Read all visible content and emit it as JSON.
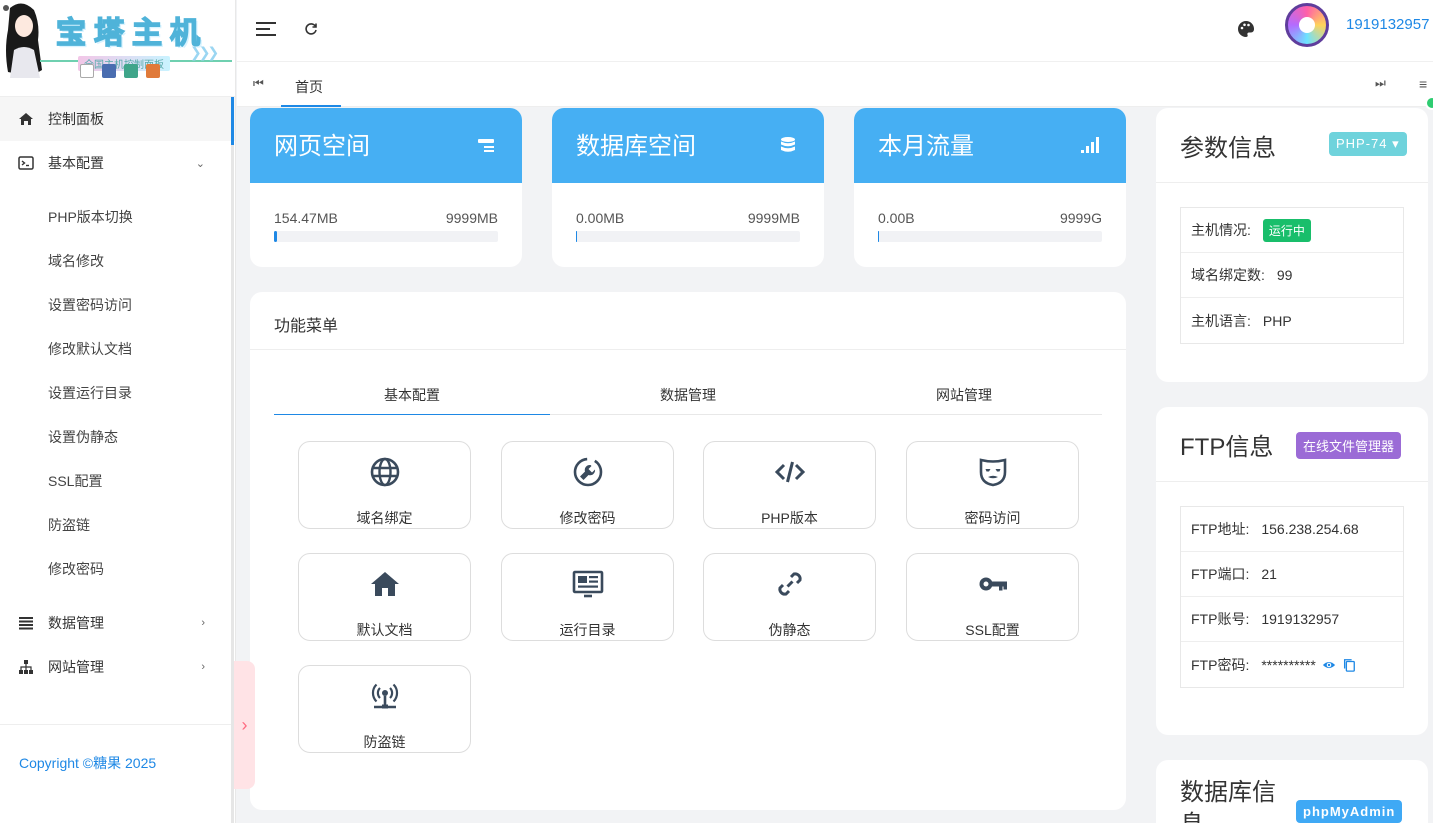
{
  "brand": {
    "title": "宝塔主机",
    "subtitle": "全国主机控制面板"
  },
  "sidebar": {
    "items": [
      {
        "label": "控制面板",
        "icon": "home-icon"
      },
      {
        "label": "基本配置",
        "icon": "terminal-icon"
      },
      {
        "label": "数据管理",
        "icon": "list-icon"
      },
      {
        "label": "网站管理",
        "icon": "sitemap-icon"
      }
    ],
    "sub_items": [
      "PHP版本切换",
      "域名修改",
      "设置密码访问",
      "修改默认文档",
      "设置运行目录",
      "设置伪静态",
      "SSL配置",
      "防盗链",
      "修改密码"
    ],
    "copyright": "Copyright ©糖果 2025"
  },
  "header": {
    "username": "1919132957"
  },
  "tabs": {
    "home": "首页"
  },
  "stats": [
    {
      "title": "网页空间",
      "used": "154.47MB",
      "total": "9999MB",
      "percent": 1.5,
      "icon": "server-icon"
    },
    {
      "title": "数据库空间",
      "used": "0.00MB",
      "total": "9999MB",
      "percent": 0.5,
      "icon": "database-icon"
    },
    {
      "title": "本月流量",
      "used": "0.00B",
      "total": "9999G",
      "percent": 0.5,
      "icon": "signal-icon"
    }
  ],
  "func_menu": {
    "title": "功能菜单",
    "tabs": [
      "基本配置",
      "数据管理",
      "网站管理"
    ],
    "buttons": [
      {
        "label": "域名绑定",
        "icon": "globe-icon"
      },
      {
        "label": "修改密码",
        "icon": "wrench-icon"
      },
      {
        "label": "PHP版本",
        "icon": "code-icon"
      },
      {
        "label": "密码访问",
        "icon": "mask-icon"
      },
      {
        "label": "默认文档",
        "icon": "home-icon"
      },
      {
        "label": "运行目录",
        "icon": "monitor-icon"
      },
      {
        "label": "伪静态",
        "icon": "link-icon"
      },
      {
        "label": "SSL配置",
        "icon": "key-icon"
      },
      {
        "label": "防盗链",
        "icon": "antenna-icon"
      }
    ]
  },
  "params": {
    "title": "参数信息",
    "php_badge": "PHP-74",
    "rows": [
      {
        "key": "主机情况:",
        "value": "运行中"
      },
      {
        "key": "域名绑定数:",
        "value": "99"
      },
      {
        "key": "主机语言:",
        "value": "PHP"
      }
    ]
  },
  "ftp": {
    "title": "FTP信息",
    "badge": "在线文件管理器",
    "rows": [
      {
        "key": "FTP地址:",
        "value": "156.238.254.68"
      },
      {
        "key": "FTP端口:",
        "value": "21"
      },
      {
        "key": "FTP账号:",
        "value": "1919132957"
      },
      {
        "key": "FTP密码:",
        "value": "**********"
      }
    ]
  },
  "db": {
    "title": "数据库信息",
    "badge": "phpMyAdmin"
  },
  "colors": {
    "accent": "#1e88e5",
    "card_head": "#46aff3",
    "success": "#19be6b",
    "php_badge": "#6fd3dc",
    "ftp_badge": "#9b6bd6",
    "db_badge": "#3fa9f5"
  }
}
